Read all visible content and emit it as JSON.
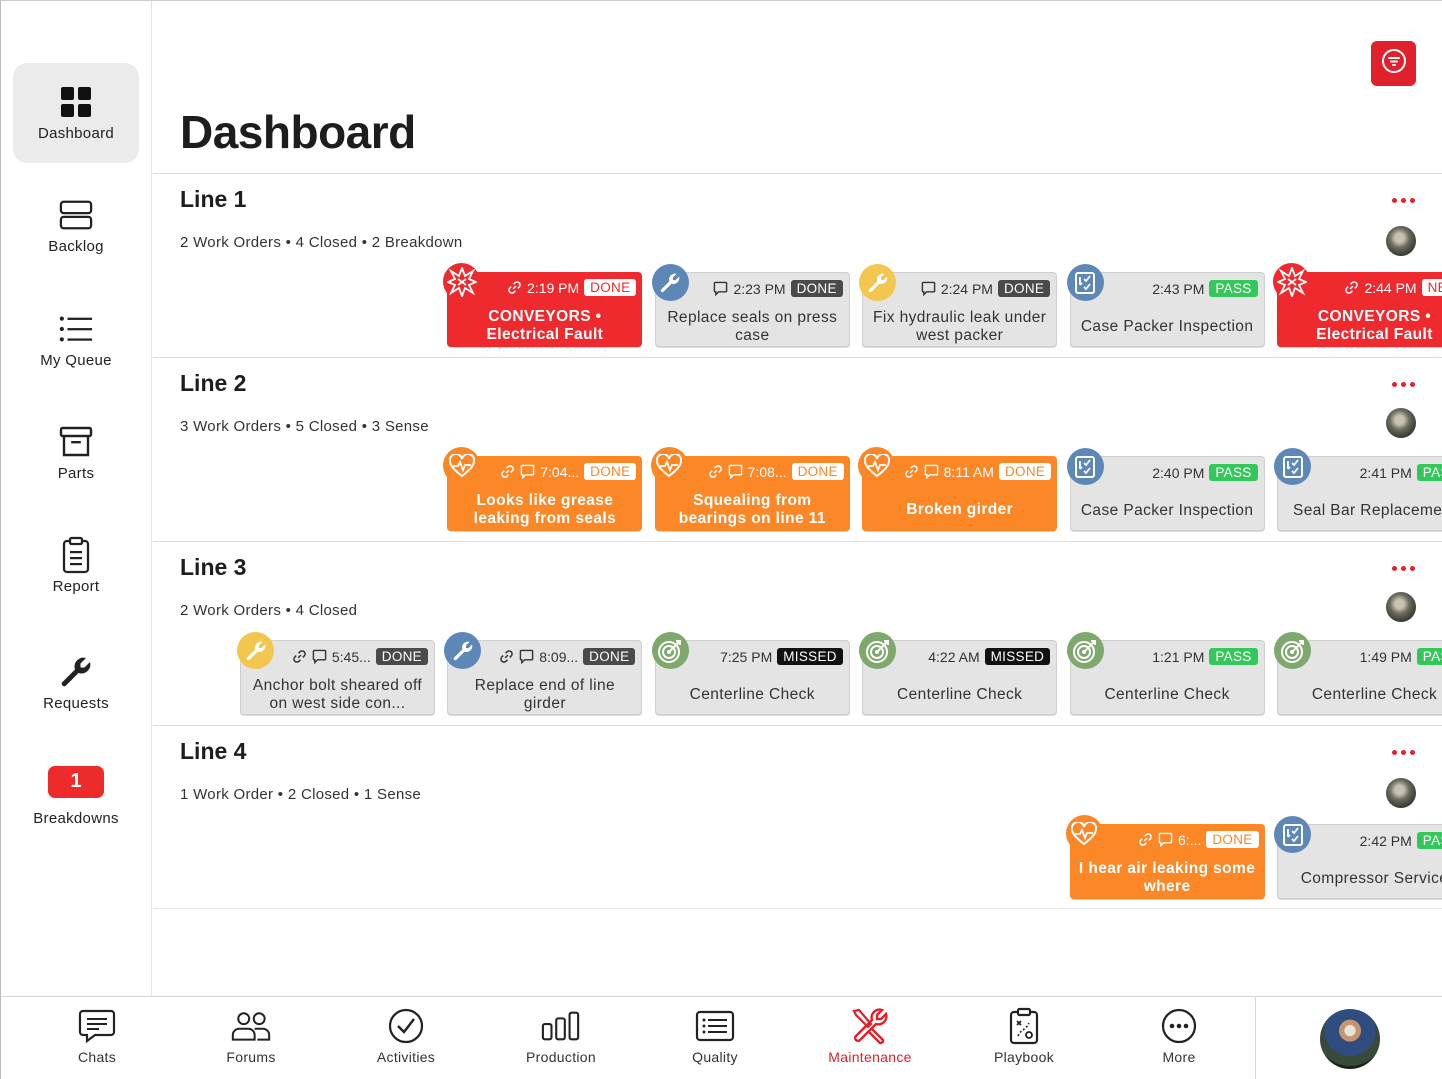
{
  "sidebar": {
    "items": [
      {
        "label": "Dashboard",
        "icon": "grid-icon",
        "active": true
      },
      {
        "label": "Backlog",
        "icon": "backlog-icon"
      },
      {
        "label": "My Queue",
        "icon": "list-icon"
      },
      {
        "label": "Parts",
        "icon": "archive-box-icon"
      },
      {
        "label": "Report",
        "icon": "clipboard-icon"
      },
      {
        "label": "Requests",
        "icon": "wrench-icon"
      },
      {
        "label": "Breakdowns",
        "badge": "1"
      }
    ]
  },
  "header": {
    "title": "Dashboard",
    "filter_icon": "filter-icon"
  },
  "colors": {
    "accent": "#e0202b",
    "breakdown": "#ee2a2e",
    "sense": "#fc8727",
    "pass": "#34c759",
    "neutral_card": "#e4e4e4"
  },
  "lines": [
    {
      "title": "Line 1",
      "summary": "2 Work Orders • 4 Closed • 2 Breakdown",
      "cards": [
        {
          "style": "red",
          "icon": "breakdown-burst-icon",
          "link": true,
          "comment": false,
          "time": "2:19 PM",
          "status": "DONE",
          "title": "CONVEYORS • Electrical Fault"
        },
        {
          "style": "grey",
          "icon": "wrench-icon",
          "icon_color": "blue",
          "link": false,
          "comment": true,
          "time": "2:23 PM",
          "status": "DONE",
          "title": "Replace seals on press case"
        },
        {
          "style": "grey",
          "icon": "wrench-icon",
          "icon_color": "yellow",
          "link": false,
          "comment": true,
          "time": "2:24 PM",
          "status": "DONE",
          "title": "Fix hydraulic leak under west packer"
        },
        {
          "style": "grey",
          "icon": "inspection-checklist-icon",
          "icon_color": "blue",
          "link": false,
          "comment": false,
          "time": "2:43 PM",
          "status": "PASS",
          "title": "Case Packer Inspection"
        },
        {
          "style": "red",
          "icon": "breakdown-burst-icon",
          "link": true,
          "comment": false,
          "time": "2:44 PM",
          "status": "NEW",
          "title": "CONVEYORS • Electrical Fault"
        }
      ]
    },
    {
      "title": "Line 2",
      "summary": "3 Work Orders • 5 Closed • 3 Sense",
      "cards": [
        {
          "style": "orange",
          "icon": "heart-pulse-icon",
          "link": true,
          "comment": true,
          "time": "7:04...",
          "status": "DONE",
          "title": "Looks like grease leaking from seals"
        },
        {
          "style": "orange",
          "icon": "heart-pulse-icon",
          "link": true,
          "comment": true,
          "time": "7:08...",
          "status": "DONE",
          "title": "Squealing from bearings on line 11"
        },
        {
          "style": "orange",
          "icon": "heart-pulse-icon",
          "link": true,
          "comment": true,
          "time": "8:11 AM",
          "status": "DONE",
          "title": "Broken girder"
        },
        {
          "style": "grey",
          "icon": "inspection-checklist-icon",
          "icon_color": "blue",
          "link": false,
          "comment": false,
          "time": "2:40 PM",
          "status": "PASS",
          "title": "Case Packer Inspection"
        },
        {
          "style": "grey",
          "icon": "inspection-checklist-icon",
          "icon_color": "blue",
          "link": false,
          "comment": false,
          "time": "2:41 PM",
          "status": "PASS",
          "title": "Seal Bar Replacement"
        }
      ]
    },
    {
      "title": "Line 3",
      "summary": "2 Work Orders • 4 Closed",
      "cards": [
        {
          "style": "grey",
          "icon": "wrench-icon",
          "icon_color": "yellow",
          "link": true,
          "comment": true,
          "time": "5:45...",
          "status": "DONE",
          "title": "Anchor bolt sheared off on west side con..."
        },
        {
          "style": "grey",
          "icon": "wrench-icon",
          "icon_color": "blue",
          "link": true,
          "comment": true,
          "time": "8:09...",
          "status": "DONE",
          "title": "Replace end of line girder"
        },
        {
          "style": "grey",
          "icon": "target-icon",
          "icon_color": "green",
          "link": false,
          "comment": false,
          "time": "7:25 PM",
          "status": "MISSED",
          "title": "Centerline Check"
        },
        {
          "style": "grey",
          "icon": "target-icon",
          "icon_color": "green",
          "link": false,
          "comment": false,
          "time": "4:22 AM",
          "status": "MISSED",
          "title": "Centerline Check"
        },
        {
          "style": "grey",
          "icon": "target-icon",
          "icon_color": "green",
          "link": false,
          "comment": false,
          "time": "1:21 PM",
          "status": "PASS",
          "title": "Centerline Check"
        },
        {
          "style": "grey",
          "icon": "target-icon",
          "icon_color": "green",
          "link": false,
          "comment": false,
          "time": "1:49 PM",
          "status": "PASS",
          "title": "Centerline Check"
        }
      ]
    },
    {
      "title": "Line 4",
      "summary": "1 Work Order • 2 Closed • 1 Sense",
      "cards": [
        {
          "style": "orange",
          "icon": "heart-pulse-icon",
          "link": true,
          "comment": true,
          "time": "6:...",
          "status": "DONE",
          "title": "I hear air leaking some where"
        },
        {
          "style": "grey",
          "icon": "inspection-checklist-icon",
          "icon_color": "blue",
          "link": false,
          "comment": false,
          "time": "2:42 PM",
          "status": "PASS",
          "title": "Compressor Service"
        }
      ]
    }
  ],
  "tabs": [
    {
      "label": "Chats",
      "icon": "chat-icon"
    },
    {
      "label": "Forums",
      "icon": "people-icon"
    },
    {
      "label": "Activities",
      "icon": "checkmark-circle-icon"
    },
    {
      "label": "Production",
      "icon": "bar-chart-icon"
    },
    {
      "label": "Quality",
      "icon": "document-list-icon"
    },
    {
      "label": "Maintenance",
      "icon": "tools-icon",
      "active": true
    },
    {
      "label": "Playbook",
      "icon": "playbook-icon"
    },
    {
      "label": "More",
      "icon": "more-dots-icon"
    }
  ],
  "profile": {
    "icon": "user-avatar"
  }
}
